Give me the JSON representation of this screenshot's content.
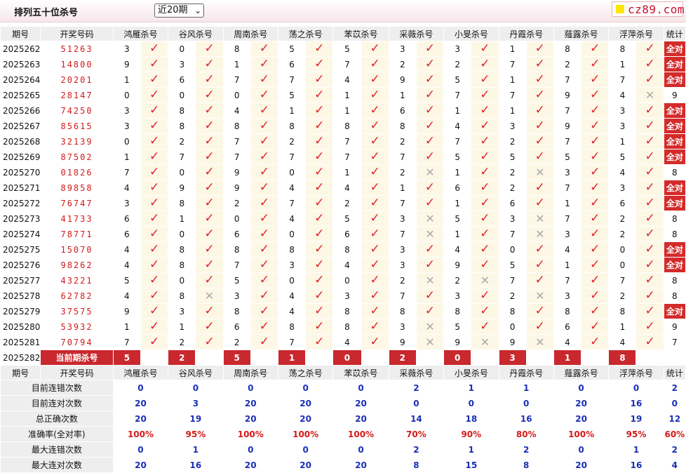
{
  "title": "排列五十位杀号",
  "period_select": "近20期",
  "logo_text": "cz89.com",
  "columns": [
    "期号",
    "开奖号码",
    "鸿雁杀号",
    "谷风杀号",
    "周南杀号",
    "荡之杀号",
    "苯苡杀号",
    "采薇杀号",
    "小旻杀号",
    "丹霞杀号",
    "薤露杀号",
    "浮萍杀号",
    "统计"
  ],
  "rows": [
    {
      "issue": "2025262",
      "draw": "51263",
      "kills": [
        3,
        0,
        8,
        5,
        5,
        3,
        3,
        1,
        8,
        8
      ],
      "ok": [
        1,
        1,
        1,
        1,
        1,
        1,
        1,
        1,
        1,
        1
      ],
      "stat": "全对"
    },
    {
      "issue": "2025263",
      "draw": "14800",
      "kills": [
        9,
        3,
        1,
        6,
        7,
        2,
        2,
        7,
        2,
        1
      ],
      "ok": [
        1,
        1,
        1,
        1,
        1,
        1,
        1,
        1,
        1,
        1
      ],
      "stat": "全对"
    },
    {
      "issue": "2025264",
      "draw": "20201",
      "kills": [
        1,
        6,
        7,
        7,
        4,
        9,
        5,
        1,
        7,
        7
      ],
      "ok": [
        1,
        1,
        1,
        1,
        1,
        1,
        1,
        1,
        1,
        1
      ],
      "stat": "全对"
    },
    {
      "issue": "2025265",
      "draw": "28147",
      "kills": [
        0,
        0,
        0,
        5,
        1,
        1,
        7,
        7,
        9,
        4
      ],
      "ok": [
        1,
        1,
        1,
        1,
        1,
        1,
        1,
        1,
        1,
        0
      ],
      "stat": "9"
    },
    {
      "issue": "2025266",
      "draw": "74250",
      "kills": [
        3,
        8,
        4,
        1,
        1,
        6,
        1,
        1,
        7,
        3
      ],
      "ok": [
        1,
        1,
        1,
        1,
        1,
        1,
        1,
        1,
        1,
        1
      ],
      "stat": "全对"
    },
    {
      "issue": "2025267",
      "draw": "85615",
      "kills": [
        3,
        8,
        8,
        8,
        8,
        8,
        4,
        3,
        9,
        3
      ],
      "ok": [
        1,
        1,
        1,
        1,
        1,
        1,
        1,
        1,
        1,
        1
      ],
      "stat": "全对"
    },
    {
      "issue": "2025268",
      "draw": "32139",
      "kills": [
        0,
        2,
        7,
        2,
        7,
        2,
        7,
        2,
        7,
        1
      ],
      "ok": [
        1,
        1,
        1,
        1,
        1,
        1,
        1,
        1,
        1,
        1
      ],
      "stat": "全对"
    },
    {
      "issue": "2025269",
      "draw": "87502",
      "kills": [
        1,
        7,
        7,
        7,
        7,
        7,
        5,
        5,
        5,
        5
      ],
      "ok": [
        1,
        1,
        1,
        1,
        1,
        1,
        1,
        1,
        1,
        1
      ],
      "stat": "全对"
    },
    {
      "issue": "2025270",
      "draw": "01826",
      "kills": [
        7,
        0,
        9,
        0,
        1,
        2,
        1,
        2,
        3,
        4
      ],
      "ok": [
        1,
        1,
        1,
        1,
        1,
        0,
        1,
        0,
        1,
        1
      ],
      "stat": "8"
    },
    {
      "issue": "2025271",
      "draw": "89858",
      "kills": [
        4,
        9,
        9,
        4,
        4,
        1,
        6,
        2,
        7,
        3
      ],
      "ok": [
        1,
        1,
        1,
        1,
        1,
        1,
        1,
        1,
        1,
        1
      ],
      "stat": "全对"
    },
    {
      "issue": "2025272",
      "draw": "76747",
      "kills": [
        3,
        8,
        2,
        7,
        2,
        7,
        1,
        6,
        1,
        6
      ],
      "ok": [
        1,
        1,
        1,
        1,
        1,
        1,
        1,
        1,
        1,
        1
      ],
      "stat": "全对"
    },
    {
      "issue": "2025273",
      "draw": "41733",
      "kills": [
        6,
        1,
        0,
        4,
        5,
        3,
        5,
        3,
        7,
        2
      ],
      "ok": [
        1,
        1,
        1,
        1,
        1,
        0,
        1,
        0,
        1,
        1
      ],
      "stat": "8"
    },
    {
      "issue": "2025274",
      "draw": "78771",
      "kills": [
        6,
        0,
        6,
        0,
        6,
        7,
        1,
        7,
        3,
        2
      ],
      "ok": [
        1,
        1,
        1,
        1,
        1,
        0,
        1,
        0,
        1,
        1
      ],
      "stat": "8"
    },
    {
      "issue": "2025275",
      "draw": "15070",
      "kills": [
        4,
        8,
        8,
        8,
        8,
        3,
        4,
        0,
        4,
        0
      ],
      "ok": [
        1,
        1,
        1,
        1,
        1,
        1,
        1,
        1,
        1,
        1
      ],
      "stat": "全对"
    },
    {
      "issue": "2025276",
      "draw": "98262",
      "kills": [
        4,
        8,
        7,
        3,
        4,
        3,
        9,
        5,
        1,
        0
      ],
      "ok": [
        1,
        1,
        1,
        1,
        1,
        1,
        1,
        1,
        1,
        1
      ],
      "stat": "全对"
    },
    {
      "issue": "2025277",
      "draw": "43221",
      "kills": [
        5,
        0,
        5,
        0,
        0,
        2,
        2,
        7,
        7,
        7
      ],
      "ok": [
        1,
        1,
        1,
        1,
        1,
        0,
        0,
        1,
        1,
        1
      ],
      "stat": "8"
    },
    {
      "issue": "2025278",
      "draw": "62782",
      "kills": [
        4,
        8,
        3,
        4,
        3,
        7,
        3,
        2,
        3,
        2
      ],
      "ok": [
        1,
        0,
        1,
        1,
        1,
        1,
        1,
        0,
        1,
        1
      ],
      "stat": "8"
    },
    {
      "issue": "2025279",
      "draw": "37575",
      "kills": [
        9,
        3,
        8,
        4,
        8,
        8,
        8,
        8,
        8,
        8
      ],
      "ok": [
        1,
        1,
        1,
        1,
        1,
        1,
        1,
        1,
        1,
        1
      ],
      "stat": "全对"
    },
    {
      "issue": "2025280",
      "draw": "53932",
      "kills": [
        1,
        1,
        6,
        8,
        8,
        3,
        5,
        0,
        6,
        1
      ],
      "ok": [
        1,
        1,
        1,
        1,
        1,
        0,
        1,
        1,
        1,
        1
      ],
      "stat": "9"
    },
    {
      "issue": "2025281",
      "draw": "70794",
      "kills": [
        7,
        2,
        2,
        7,
        4,
        9,
        9,
        9,
        4,
        4
      ],
      "ok": [
        1,
        1,
        1,
        1,
        1,
        0,
        0,
        0,
        1,
        1
      ],
      "stat": "7"
    }
  ],
  "current": {
    "issue": "2025282",
    "label": "当前期杀号",
    "kills": [
      "5",
      "2",
      "5",
      "1",
      "0",
      "2",
      "0",
      "3",
      "1",
      "8"
    ]
  },
  "stats": [
    {
      "label": "目前连错次数",
      "values": [
        "0",
        "0",
        "0",
        "0",
        "0",
        "2",
        "1",
        "1",
        "0",
        "0",
        "2"
      ],
      "red": false
    },
    {
      "label": "目前连对次数",
      "values": [
        "20",
        "3",
        "20",
        "20",
        "20",
        "0",
        "0",
        "0",
        "20",
        "16",
        "0"
      ],
      "red": false
    },
    {
      "label": "总正确次数",
      "values": [
        "20",
        "19",
        "20",
        "20",
        "20",
        "14",
        "18",
        "16",
        "20",
        "19",
        "12"
      ],
      "red": false
    },
    {
      "label": "准确率(全对率)",
      "values": [
        "100%",
        "95%",
        "100%",
        "100%",
        "100%",
        "70%",
        "90%",
        "80%",
        "100%",
        "95%",
        "60%"
      ],
      "red": true
    },
    {
      "label": "最大连错次数",
      "values": [
        "0",
        "1",
        "0",
        "0",
        "0",
        "2",
        "1",
        "2",
        "0",
        "1",
        "2"
      ],
      "red": false
    },
    {
      "label": "最大连对次数",
      "values": [
        "20",
        "16",
        "20",
        "20",
        "20",
        "8",
        "15",
        "8",
        "20",
        "16",
        "4"
      ],
      "red": false
    }
  ],
  "icons": {
    "ok": "check-icon",
    "wrong": "cross-icon"
  },
  "colors": {
    "accent": "#d42a2a",
    "blue": "#1a2fb8",
    "tick": "#e0222a"
  }
}
